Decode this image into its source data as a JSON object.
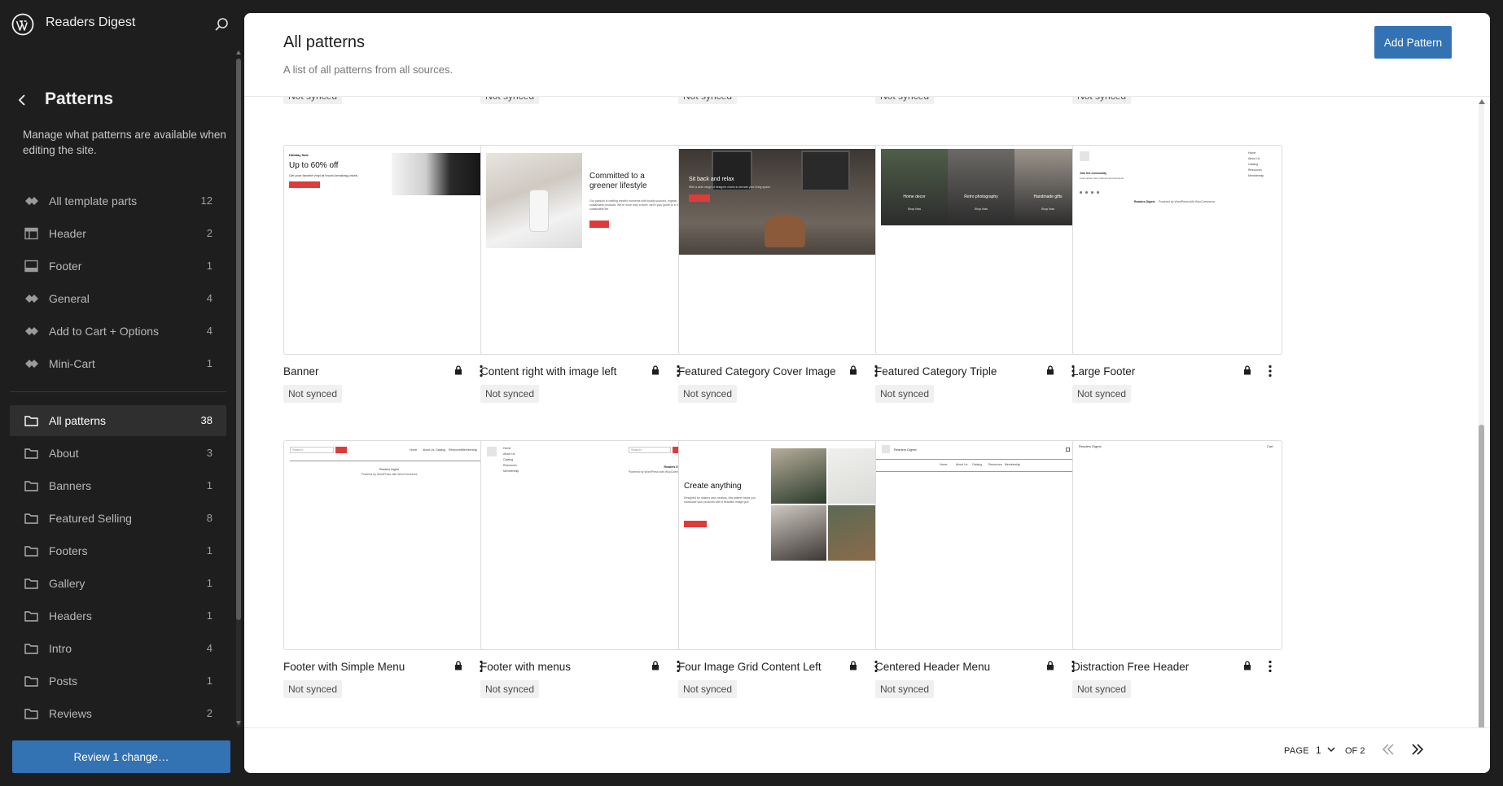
{
  "site": {
    "title": "Readers Digest"
  },
  "sidebar": {
    "heading": "Patterns",
    "description": "Manage what patterns are available when editing the site.",
    "template_parts": [
      {
        "label": "All template parts",
        "count": "12",
        "icon": "template-parts-icon"
      },
      {
        "label": "Header",
        "count": "2",
        "icon": "header-icon"
      },
      {
        "label": "Footer",
        "count": "1",
        "icon": "footer-icon"
      },
      {
        "label": "General",
        "count": "4",
        "icon": "template-parts-icon"
      },
      {
        "label": "Add to Cart + Options",
        "count": "4",
        "icon": "template-parts-icon"
      },
      {
        "label": "Mini-Cart",
        "count": "1",
        "icon": "template-parts-icon"
      }
    ],
    "categories": [
      {
        "label": "All patterns",
        "count": "38",
        "active": true
      },
      {
        "label": "About",
        "count": "3"
      },
      {
        "label": "Banners",
        "count": "1"
      },
      {
        "label": "Featured Selling",
        "count": "8"
      },
      {
        "label": "Footers",
        "count": "1"
      },
      {
        "label": "Gallery",
        "count": "1"
      },
      {
        "label": "Headers",
        "count": "1"
      },
      {
        "label": "Intro",
        "count": "4"
      },
      {
        "label": "Posts",
        "count": "1"
      },
      {
        "label": "Reviews",
        "count": "2"
      }
    ],
    "review_button": "Review 1 change…"
  },
  "main": {
    "title": "All patterns",
    "subtitle": "A list of all patterns from all sources.",
    "add_button": "Add Pattern",
    "sync_label": "Not synced",
    "patterns": [
      {
        "title": "Banner",
        "thumb": {
          "kicker": "Holiday Sale",
          "heading": "Up to 60% off",
          "body": "Get your favorite vinyl at record-breaking prices."
        }
      },
      {
        "title": "Content right with image left",
        "thumb": {
          "heading": "Committed to a greener lifestyle",
          "body": "Our passion is crafting mindful moments with locally sourced, organic, and sustainable products. We're more than a store; we're your guide to a more sustainable life."
        }
      },
      {
        "title": "Featured Category Cover Image",
        "thumb": {
          "heading": "Sit back and relax",
          "body": "With a wide range of designer chairs to elevate your living space."
        }
      },
      {
        "title": "Featured Category Triple",
        "thumb": {
          "labels": [
            "Home decor",
            "Retro photography",
            "Handmade gifts"
          ],
          "cta": "Shop Now"
        }
      },
      {
        "title": "Large Footer",
        "thumb": {
          "heading": "Join the community",
          "body": "Learn about new products and discounts",
          "menu": [
            "Home",
            "About Us",
            "Catalog",
            "Resources",
            "Membership"
          ],
          "credit_site": "Readers Digest",
          "credit_text": "Powered by WordPress with WooCommerce"
        }
      },
      {
        "title": "Footer with Simple Menu",
        "thumb": {
          "search": "Search",
          "menu": [
            "Home",
            "About Us",
            "Catalog",
            "Resources",
            "Membership"
          ],
          "credit_site": "Readers Digest",
          "credit_text": "Powered by WordPress with WooCommerce"
        }
      },
      {
        "title": "Footer with menus",
        "thumb": {
          "search": "Search",
          "menu": [
            "Home",
            "About Us",
            "Catalog",
            "Resources",
            "Membership"
          ],
          "credit_site": "Readers Digest",
          "credit_text": "Powered by WordPress with WooCommerce"
        }
      },
      {
        "title": "Four Image Grid Content Left",
        "thumb": {
          "heading": "Create anything",
          "body": "Designed for makers and creators, this pattern helps you showcase your products with a beautiful image grid.",
          "cta": "Shop Now"
        }
      },
      {
        "title": "Centered Header Menu",
        "thumb": {
          "site": "Readers Digest",
          "menu": [
            "Home",
            "About Us",
            "Catalog",
            "Resources",
            "Membership"
          ]
        }
      },
      {
        "title": "Distraction Free Header",
        "thumb": {
          "site": "Readers Digest",
          "cart": "Cart"
        }
      }
    ]
  },
  "pagination": {
    "page_label": "PAGE",
    "page": "1",
    "of_label": "OF 2"
  },
  "colors": {
    "accent": "#3372b3",
    "sale_red": "#e03b3b",
    "sidebar_bg": "#1e1e1e"
  }
}
